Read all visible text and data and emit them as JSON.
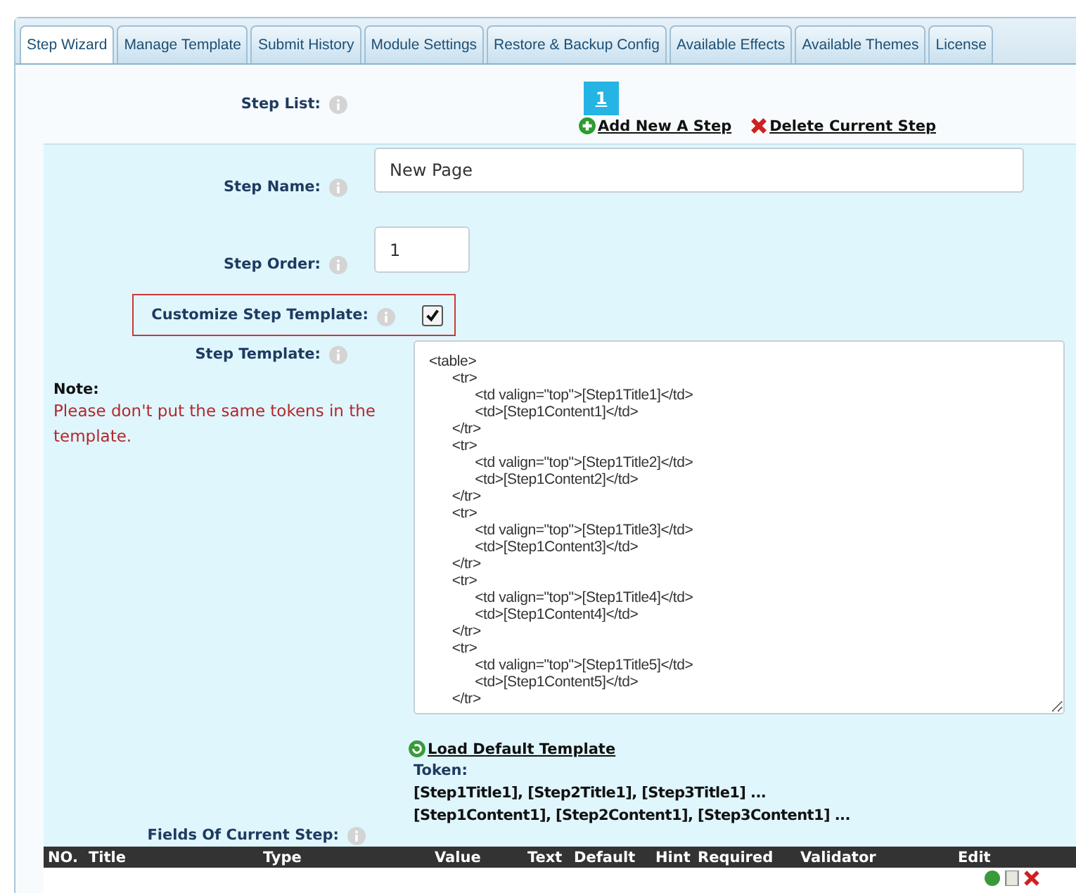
{
  "tabs": [
    {
      "label": "Step Wizard",
      "selected": true
    },
    {
      "label": "Manage Template",
      "selected": false
    },
    {
      "label": "Submit History",
      "selected": false
    },
    {
      "label": "Module Settings",
      "selected": false
    },
    {
      "label": "Restore & Backup Config",
      "selected": false
    },
    {
      "label": "Available Effects",
      "selected": false
    },
    {
      "label": "Available Themes",
      "selected": false
    },
    {
      "label": "License",
      "selected": false
    }
  ],
  "step_list": {
    "label": "Step List:",
    "steps": [
      {
        "label": "1",
        "selected": true
      }
    ],
    "add_link": "Add New A Step",
    "delete_link": "Delete Current Step"
  },
  "step_name": {
    "label": "Step Name:",
    "value": "New Page"
  },
  "step_order": {
    "label": "Step Order:",
    "value": "1"
  },
  "customize_template": {
    "label": "Customize Step Template:",
    "checked": true
  },
  "step_template": {
    "label": "Step Template:",
    "value": "<table>\n\t<tr>\n\t\t<td valign=\"top\">[Step1Title1]</td>\n\t\t<td>[Step1Content1]</td>\n\t</tr>\n\t<tr>\n\t\t<td valign=\"top\">[Step1Title2]</td>\n\t\t<td>[Step1Content2]</td>\n\t</tr>\n\t<tr>\n\t\t<td valign=\"top\">[Step1Title3]</td>\n\t\t<td>[Step1Content3]</td>\n\t</tr>\n\t<tr>\n\t\t<td valign=\"top\">[Step1Title4]</td>\n\t\t<td>[Step1Content4]</td>\n\t</tr>\n\t<tr>\n\t\t<td valign=\"top\">[Step1Title5]</td>\n\t\t<td>[Step1Content5]</td>\n\t</tr>"
  },
  "note": {
    "title": "Note:",
    "text": "Please don't put the same tokens in the template."
  },
  "load_default_link": "Load Default Template",
  "token": {
    "label": "Token:",
    "lines": [
      "[Step1Title1], [Step2Title1], [Step3Title1] ...",
      "[Step1Content1], [Step2Content1], [Step3Content1] ..."
    ]
  },
  "fields_label": "Fields Of Current Step:",
  "fields_table": {
    "columns": [
      "NO.",
      "Title",
      "Type",
      "Value",
      "Text",
      "Default",
      "Hint",
      "Required",
      "Validator",
      "Edit"
    ]
  }
}
